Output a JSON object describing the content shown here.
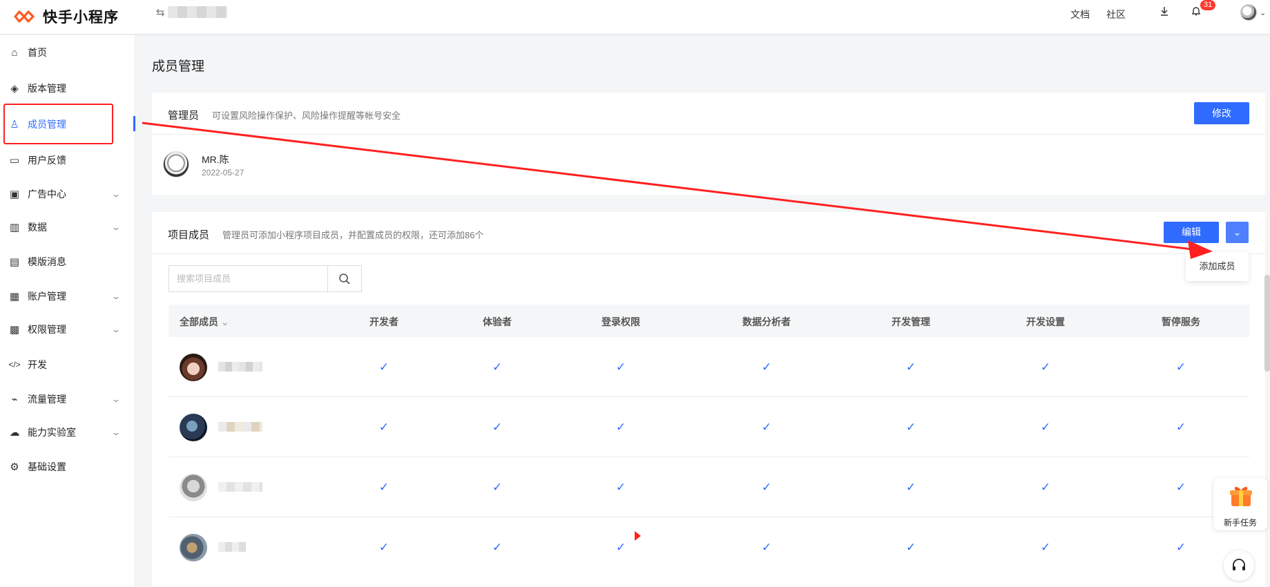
{
  "header": {
    "app_name": "快手小程序",
    "switch_icon": "⇆",
    "links": [
      "文档",
      "社区"
    ],
    "notification_count": "31"
  },
  "sidebar": {
    "items": [
      {
        "label": "首页",
        "icon": "home-icon",
        "glyph": "⌂"
      },
      {
        "label": "版本管理",
        "icon": "layers-icon",
        "glyph": "◈"
      },
      {
        "label": "成员管理",
        "icon": "user-icon",
        "glyph": "♙"
      },
      {
        "label": "用户反馈",
        "icon": "message-icon",
        "glyph": "▭"
      },
      {
        "label": "广告中心",
        "icon": "ad-icon",
        "glyph": "▣"
      },
      {
        "label": "数据",
        "icon": "chart-icon",
        "glyph": "▥"
      },
      {
        "label": "模版消息",
        "icon": "template-icon",
        "glyph": "▤"
      },
      {
        "label": "账户管理",
        "icon": "account-icon",
        "glyph": "▦"
      },
      {
        "label": "权限管理",
        "icon": "lock-icon",
        "glyph": "▩"
      },
      {
        "label": "开发",
        "icon": "code-icon",
        "glyph": "</>"
      },
      {
        "label": "流量管理",
        "icon": "trend-icon",
        "glyph": "⌁"
      },
      {
        "label": "能力实验室",
        "icon": "cloud-icon",
        "glyph": "☁"
      },
      {
        "label": "基础设置",
        "icon": "gear-icon",
        "glyph": "⚙"
      }
    ]
  },
  "page": {
    "title": "成员管理"
  },
  "admin": {
    "title": "管理员",
    "desc": "可设置风险操作保护、风险操作提醒等帐号安全",
    "edit_label": "修改",
    "name": "MR.陈",
    "date": "2022-05-27"
  },
  "members": {
    "title": "项目成员",
    "desc": "管理员可添加小程序项目成员，并配置成员的权限，还可添加86个",
    "edit_label": "编辑",
    "dropdown_item": "添加成员",
    "search_placeholder": "搜索项目成员",
    "filter_label": "全部成员",
    "columns": [
      "开发者",
      "体验者",
      "登录权限",
      "数据分析者",
      "开发管理",
      "开发设置",
      "暂停服务"
    ],
    "row_count": 4,
    "checks_per_row": 7
  },
  "floating": {
    "task_label": "新手任务"
  },
  "colors": {
    "accent": "#2f6bff",
    "annotation_red": "#ff2020",
    "badge_red": "#ff3b30"
  }
}
